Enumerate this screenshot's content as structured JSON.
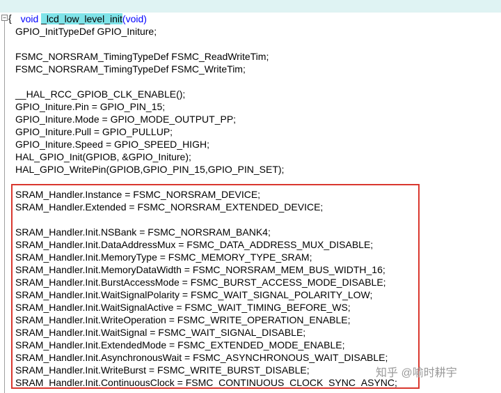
{
  "function_signature": {
    "return_type": "void",
    "name": "_lcd_low_level_init",
    "open_paren": "(",
    "param": "void",
    "close_paren": ")"
  },
  "open_brace": "{",
  "fold_marker": "−",
  "code_lines": [
    {
      "text": "GPIO_InitTypeDef GPIO_Initure;",
      "highlighted": false
    },
    {
      "text": "FSMC_NORSRAM_TimingTypeDef FSMC_ReadWriteTim;",
      "highlighted": false
    },
    {
      "text": "FSMC_NORSRAM_TimingTypeDef FSMC_WriteTim;",
      "highlighted": false
    },
    {
      "text": "__HAL_RCC_GPIOB_CLK_ENABLE();",
      "highlighted": false
    },
    {
      "text": "GPIO_Initure.Pin = GPIO_PIN_15;",
      "highlighted": false
    },
    {
      "text": "GPIO_Initure.Mode = GPIO_MODE_OUTPUT_PP;",
      "highlighted": false
    },
    {
      "text": "GPIO_Initure.Pull = GPIO_PULLUP;",
      "highlighted": false
    },
    {
      "text": "GPIO_Initure.Speed = GPIO_SPEED_HIGH;",
      "highlighted": false
    },
    {
      "text": "HAL_GPIO_Init(GPIOB, &GPIO_Initure);",
      "highlighted": false
    },
    {
      "text": "HAL_GPIO_WritePin(GPIOB,GPIO_PIN_15,GPIO_PIN_SET);",
      "highlighted": false
    },
    {
      "text": "SRAM_Handler.Instance = FSMC_NORSRAM_DEVICE;",
      "highlighted": true
    },
    {
      "text": "SRAM_Handler.Extended = FSMC_NORSRAM_EXTENDED_DEVICE;",
      "highlighted": true
    },
    {
      "text": "SRAM_Handler.Init.NSBank = FSMC_NORSRAM_BANK4;",
      "highlighted": true
    },
    {
      "text": "SRAM_Handler.Init.DataAddressMux = FSMC_DATA_ADDRESS_MUX_DISABLE;",
      "highlighted": true
    },
    {
      "text": "SRAM_Handler.Init.MemoryType = FSMC_MEMORY_TYPE_SRAM;",
      "highlighted": true
    },
    {
      "text": "SRAM_Handler.Init.MemoryDataWidth = FSMC_NORSRAM_MEM_BUS_WIDTH_16;",
      "highlighted": true
    },
    {
      "text": "SRAM_Handler.Init.BurstAccessMode = FSMC_BURST_ACCESS_MODE_DISABLE;",
      "highlighted": true
    },
    {
      "text": "SRAM_Handler.Init.WaitSignalPolarity = FSMC_WAIT_SIGNAL_POLARITY_LOW;",
      "highlighted": true
    },
    {
      "text": "SRAM_Handler.Init.WaitSignalActive = FSMC_WAIT_TIMING_BEFORE_WS;",
      "highlighted": true
    },
    {
      "text": "SRAM_Handler.Init.WriteOperation = FSMC_WRITE_OPERATION_ENABLE;",
      "highlighted": true
    },
    {
      "text": "SRAM_Handler.Init.WaitSignal = FSMC_WAIT_SIGNAL_DISABLE;",
      "highlighted": true
    },
    {
      "text": "SRAM_Handler.Init.ExtendedMode = FSMC_EXTENDED_MODE_ENABLE;",
      "highlighted": true
    },
    {
      "text": "SRAM_Handler.Init.AsynchronousWait = FSMC_ASYNCHRONOUS_WAIT_DISABLE;",
      "highlighted": true
    },
    {
      "text": "SRAM_Handler.Init.WriteBurst = FSMC_WRITE_BURST_DISABLE;",
      "highlighted": true
    },
    {
      "text": "SRAM_Handler.Init.ContinuousClock = FSMC_CONTINUOUS_CLOCK_SYNC_ASYNC;",
      "highlighted": true
    }
  ],
  "highlight_color": "#d9372e",
  "watermark": "知乎 @喻时耕宇"
}
